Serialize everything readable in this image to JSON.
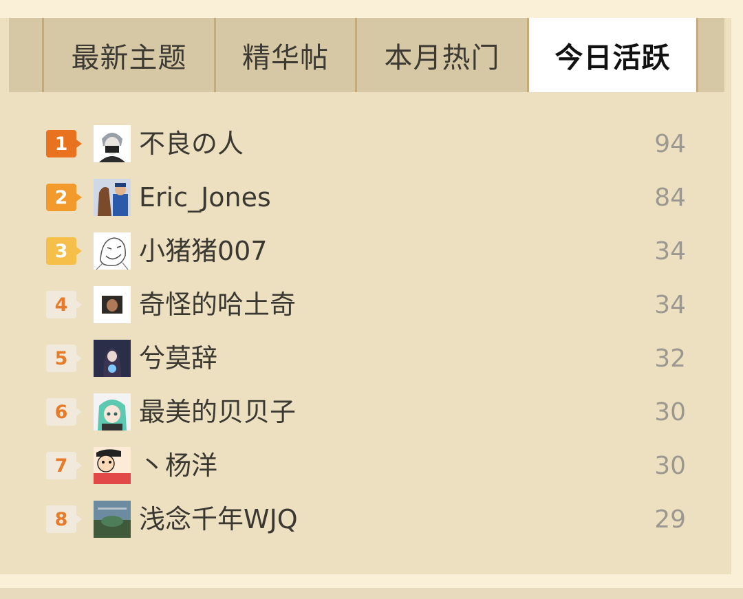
{
  "tabs": [
    {
      "label": "最新主题",
      "active": false
    },
    {
      "label": "精华帖",
      "active": false
    },
    {
      "label": "本月热门",
      "active": false
    },
    {
      "label": "今日活跃",
      "active": true
    }
  ],
  "ranking": [
    {
      "rank": "1",
      "name": "不良の人",
      "count": "94"
    },
    {
      "rank": "2",
      "name": "Eric_Jones",
      "count": "84"
    },
    {
      "rank": "3",
      "name": "小猪猪007",
      "count": "34"
    },
    {
      "rank": "4",
      "name": "奇怪的哈土奇",
      "count": "34"
    },
    {
      "rank": "5",
      "name": "兮莫辞",
      "count": "32"
    },
    {
      "rank": "6",
      "name": "最美的贝贝子",
      "count": "30"
    },
    {
      "rank": "7",
      "name": "丶杨洋",
      "count": "30"
    },
    {
      "rank": "8",
      "name": "浅念千年WJQ",
      "count": "29"
    }
  ],
  "colors": {
    "background": "#faf0d8",
    "panel": "#ede0c1",
    "tab_bar": "#d7c8a5",
    "active_tab": "#ffffff",
    "rank1": "#e8721d",
    "rank2": "#f29a2b",
    "rank3": "#f5bf4a"
  }
}
